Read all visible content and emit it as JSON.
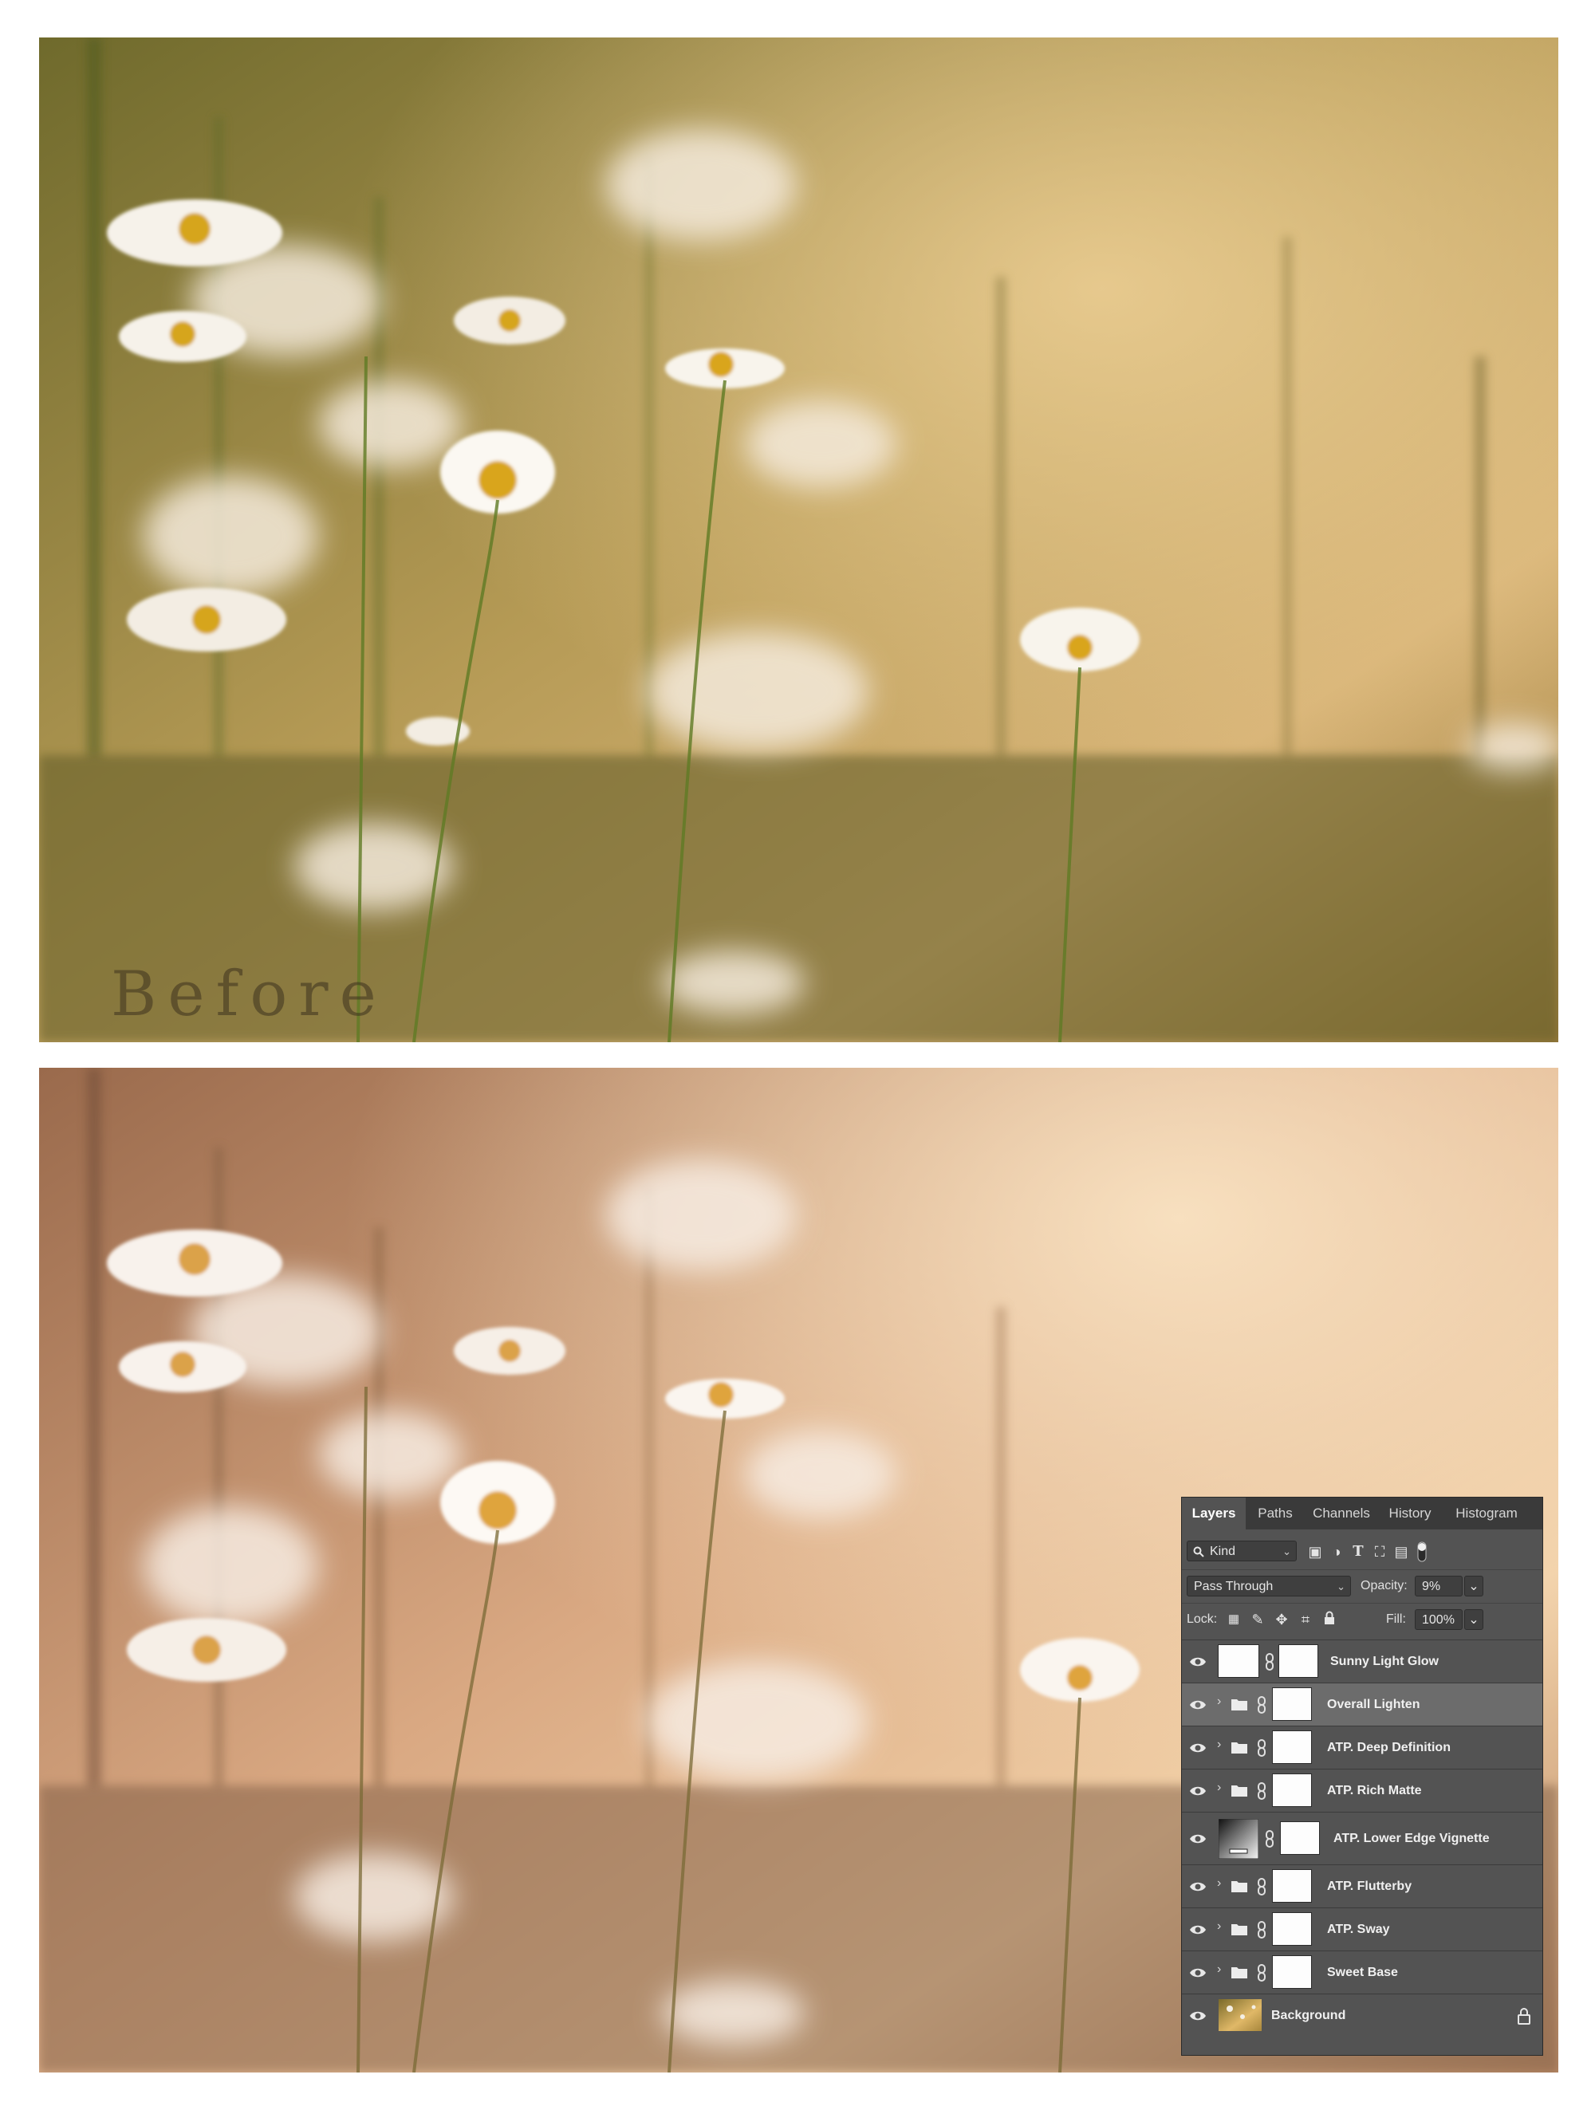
{
  "before_label": "Before",
  "panel": {
    "tabs": [
      "Layers",
      "Paths",
      "Channels",
      "History",
      "Histogram"
    ],
    "active_tab": "Layers",
    "filter": {
      "kind_label": "Kind",
      "filter_icons": [
        "image-filter-icon",
        "adjustment-filter-icon",
        "type-filter-icon",
        "shape-filter-icon",
        "smart-object-filter-icon",
        "filter-toggle-icon"
      ]
    },
    "blend_mode": "Pass Through",
    "opacity_label": "Opacity:",
    "opacity_value": "9%",
    "lock_label": "Lock:",
    "lock_icons": [
      "lock-transparent-icon",
      "lock-image-icon",
      "lock-position-icon",
      "lock-artboard-icon",
      "lock-all-icon"
    ],
    "fill_label": "Fill:",
    "fill_value": "100%",
    "layers": [
      {
        "name": "Sunny Light Glow",
        "type": "adjustment",
        "selected": false
      },
      {
        "name": "Overall Lighten",
        "type": "group",
        "selected": true
      },
      {
        "name": "ATP. Deep Definition",
        "type": "group",
        "selected": false
      },
      {
        "name": "ATP. Rich Matte",
        "type": "group",
        "selected": false
      },
      {
        "name": "ATP. Lower Edge Vignette",
        "type": "gradient",
        "selected": false
      },
      {
        "name": "ATP. Flutterby",
        "type": "group",
        "selected": false
      },
      {
        "name": "ATP. Sway",
        "type": "group",
        "selected": false
      },
      {
        "name": "Sweet Base",
        "type": "group",
        "selected": false
      },
      {
        "name": "Background",
        "type": "background",
        "selected": false,
        "locked": true
      }
    ]
  },
  "colors": {
    "before_bg": "#8a7a3a",
    "after_bg": "#c89470",
    "panel_bg": "#535353",
    "tab_bar": "#3a3a3a",
    "selected_layer": "#6c6c6c"
  }
}
